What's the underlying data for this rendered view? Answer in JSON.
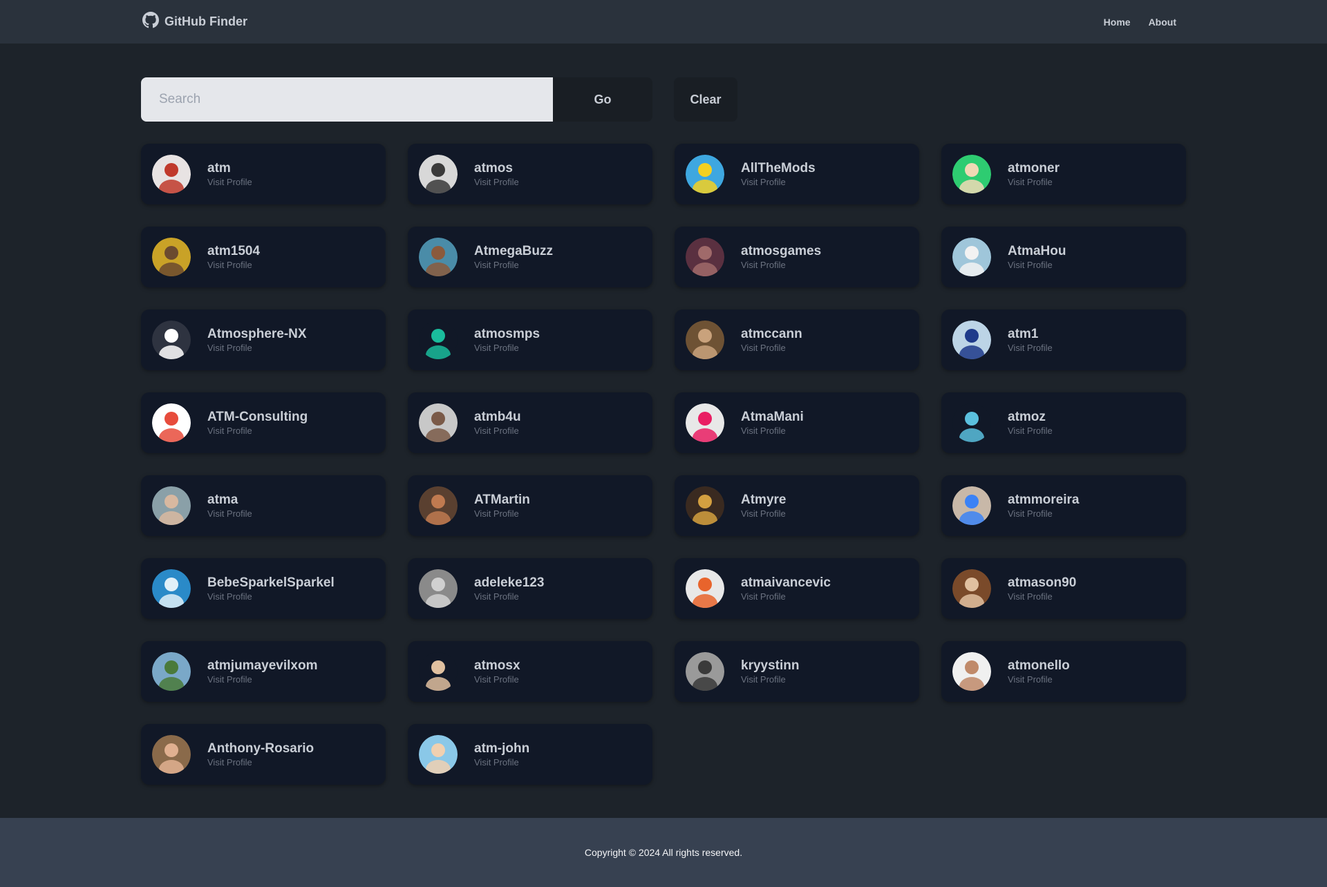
{
  "navbar": {
    "brand": "GitHub Finder",
    "brand_icon": "github-icon",
    "links": [
      "Home",
      "About"
    ]
  },
  "search": {
    "placeholder": "Search",
    "value": "",
    "go_label": "Go",
    "clear_label": "Clear"
  },
  "users": [
    {
      "login": "atm",
      "link": "Visit Profile",
      "avatar_color": "#e8e3e3",
      "avatar_accent": "#c0392b"
    },
    {
      "login": "atmos",
      "link": "Visit Profile",
      "avatar_color": "#d8d8d8",
      "avatar_accent": "#3a3a3a"
    },
    {
      "login": "AllTheMods",
      "link": "Visit Profile",
      "avatar_color": "#3ea7e0",
      "avatar_accent": "#f5d020"
    },
    {
      "login": "atmoner",
      "link": "Visit Profile",
      "avatar_color": "#2ecc71",
      "avatar_accent": "#f0d9b5"
    },
    {
      "login": "atm1504",
      "link": "Visit Profile",
      "avatar_color": "#c9a227",
      "avatar_accent": "#6b4a2f"
    },
    {
      "login": "AtmegaBuzz",
      "link": "Visit Profile",
      "avatar_color": "#4a8ca8",
      "avatar_accent": "#8b5a3c"
    },
    {
      "login": "atmosgames",
      "link": "Visit Profile",
      "avatar_color": "#5a3040",
      "avatar_accent": "#a06a6a"
    },
    {
      "login": "AtmaHou",
      "link": "Visit Profile",
      "avatar_color": "#9fc6da",
      "avatar_accent": "#f2f2f2"
    },
    {
      "login": "Atmosphere-NX",
      "link": "Visit Profile",
      "avatar_color": "#2e3340",
      "avatar_accent": "#ffffff"
    },
    {
      "login": "atmosmps",
      "link": "Visit Profile",
      "avatar_color": "#111827",
      "avatar_accent": "#1abc9c"
    },
    {
      "login": "atmccann",
      "link": "Visit Profile",
      "avatar_color": "#6e5234",
      "avatar_accent": "#c9a27c"
    },
    {
      "login": "atm1",
      "link": "Visit Profile",
      "avatar_color": "#bcd4e6",
      "avatar_accent": "#1e3a8a"
    },
    {
      "login": "ATM-Consulting",
      "link": "Visit Profile",
      "avatar_color": "#ffffff",
      "avatar_accent": "#e74c3c"
    },
    {
      "login": "atmb4u",
      "link": "Visit Profile",
      "avatar_color": "#c8c8c8",
      "avatar_accent": "#7a5a48"
    },
    {
      "login": "AtmaMani",
      "link": "Visit Profile",
      "avatar_color": "#e8e8e8",
      "avatar_accent": "#e91e63"
    },
    {
      "login": "atmoz",
      "link": "Visit Profile",
      "avatar_color": "#111827",
      "avatar_accent": "#5bc0de"
    },
    {
      "login": "atma",
      "link": "Visit Profile",
      "avatar_color": "#8aa0a8",
      "avatar_accent": "#d8b8a0"
    },
    {
      "login": "ATMartin",
      "link": "Visit Profile",
      "avatar_color": "#5a4030",
      "avatar_accent": "#c07a50"
    },
    {
      "login": "Atmyre",
      "link": "Visit Profile",
      "avatar_color": "#3a2a20",
      "avatar_accent": "#d4a040"
    },
    {
      "login": "atmmoreira",
      "link": "Visit Profile",
      "avatar_color": "#c8b8a8",
      "avatar_accent": "#3b82f6"
    },
    {
      "login": "BebeSparkelSparkel",
      "link": "Visit Profile",
      "avatar_color": "#2a8ac8",
      "avatar_accent": "#e0f0f8"
    },
    {
      "login": "adeleke123",
      "link": "Visit Profile",
      "avatar_color": "#8a8a8a",
      "avatar_accent": "#d0d0d0"
    },
    {
      "login": "atmaivancevic",
      "link": "Visit Profile",
      "avatar_color": "#e8e8e8",
      "avatar_accent": "#e8642c"
    },
    {
      "login": "atmason90",
      "link": "Visit Profile",
      "avatar_color": "#7a4a2a",
      "avatar_accent": "#e0c0a0"
    },
    {
      "login": "atmjumayevilxom",
      "link": "Visit Profile",
      "avatar_color": "#7aa8c8",
      "avatar_accent": "#4a7a3a"
    },
    {
      "login": "atmosx",
      "link": "Visit Profile",
      "avatar_color": "#111827",
      "avatar_accent": "#e0c0a0"
    },
    {
      "login": "kryystinn",
      "link": "Visit Profile",
      "avatar_color": "#9a9a9a",
      "avatar_accent": "#3a3a3a"
    },
    {
      "login": "atmonello",
      "link": "Visit Profile",
      "avatar_color": "#f0f0f0",
      "avatar_accent": "#c08a6a"
    },
    {
      "login": "Anthony-Rosario",
      "link": "Visit Profile",
      "avatar_color": "#8a6a4a",
      "avatar_accent": "#e0b090"
    },
    {
      "login": "atm-john",
      "link": "Visit Profile",
      "avatar_color": "#8ac8e8",
      "avatar_accent": "#f0d0b0"
    }
  ],
  "footer": {
    "copyright": "Copyright © 2024 All rights reserved."
  }
}
